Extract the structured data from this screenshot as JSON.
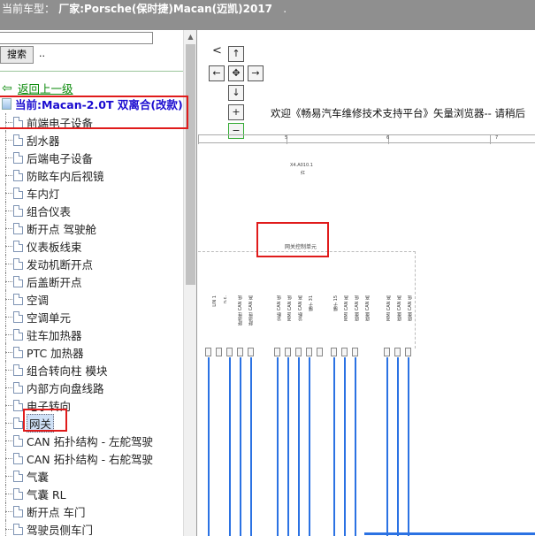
{
  "title": {
    "label": "当前车型：",
    "value": "厂家:Porsche(保时捷)Macan(迈凯)2017",
    "suffix": "."
  },
  "sidebar": {
    "search_value": "",
    "search_button": "搜索",
    "search_dots": "..",
    "back_label": "返回上一级",
    "current_label": "当前:Macan-2.0T 双离合(改款)",
    "items": [
      "前端电子设备",
      "刮水器",
      "后端电子设备",
      "防眩车内后视镜",
      "车内灯",
      "组合仪表",
      "断开点 驾驶舱",
      "仪表板线束",
      "发动机断开点",
      "后盖断开点",
      "空调",
      "空调单元",
      "驻车加热器",
      "PTC 加热器",
      "组合转向柱 模块",
      "内部方向盘线路",
      "电子转向",
      "网关",
      "CAN 拓扑结构 - 左舵驾驶",
      "CAN 拓扑结构 - 右舵驾驶",
      "气囊",
      "气囊 RL",
      "断开点 车门",
      "驾驶员侧车门"
    ],
    "selected_index": 17
  },
  "viewer": {
    "nav_left": "<",
    "btn_up": "↑",
    "btn_left": "←",
    "btn_center": "✥",
    "btn_right": "→",
    "btn_down": "↓",
    "btn_zoom_in": "+",
    "btn_zoom_out": "−",
    "welcome": "欢迎《畅易汽车维修技术支持平台》矢量浏览器-- 请稍后",
    "ruler_numbers": [
      "5",
      "6",
      "7"
    ],
    "diagram_ref": "X4.A010.1",
    "diagram_ref2": "红",
    "gateway_label": "网关控制单元",
    "pin_groups": [
      [
        "A1",
        "A2",
        "A3",
        "A4",
        "A5",
        "A6"
      ],
      [
        "A8",
        "A9",
        "A10",
        "A11",
        "A12",
        "A13",
        "A14",
        "A15"
      ],
      [
        "A17",
        "A18",
        "A19",
        "A20"
      ]
    ],
    "signal_labels": [
      "LIN 1",
      "n.c.",
      "舒适性 CAN 低",
      "舒适性 CAN 高",
      "诊断 CAN 低",
      "MMI CAN 低",
      "诊断 CAN 高",
      "端子 31",
      "端子 15",
      "MMI CAN 高",
      "底盘 CAN 低",
      "底盘 CAN 高",
      "MMI CAN 高",
      "底盘 CAN 高",
      "底盘 CAN 低"
    ]
  }
}
